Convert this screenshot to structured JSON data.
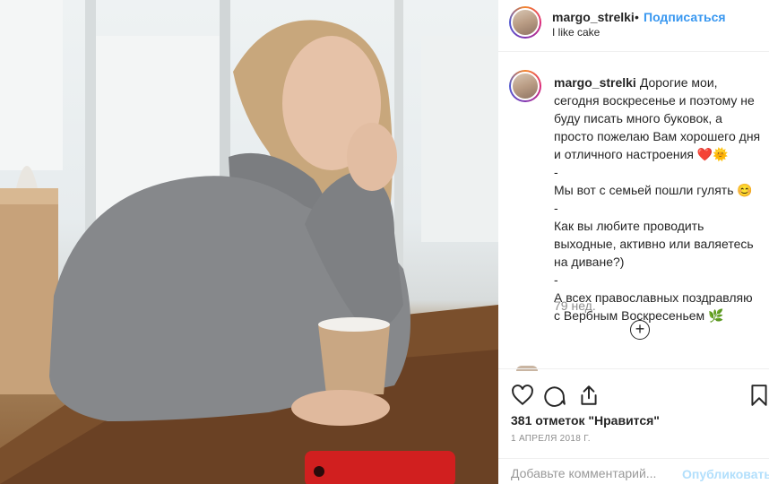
{
  "post": {
    "username": "margo_strelki",
    "dot": "•",
    "follow_label": "Подписаться",
    "location": "I like cake",
    "caption": "Дорогие мои, сегодня воскресенье и поэтому не буду писать много буковок, а просто пожелаю Вам хорошего дня и отличного настроения ❤️🌞\n-\nМы вот с семьей пошли гулять 😊\n-\nКак вы любите проводить выходные, активно или валяетесь на диване?)\n-\nА всех православных поздравляю с Вербным Воскресеньем 🌿",
    "time_ago": "79 нед.",
    "load_more_symbol": "+",
    "likes": "381 отметок \"Нравится\"",
    "date": "1 АПРЕЛЯ 2018 Г."
  },
  "comment": {
    "placeholder": "Добавьте комментарий...",
    "publish_label": "Опубликовать"
  },
  "icons": {
    "like": "heart-icon",
    "comment": "comment-icon",
    "share": "share-icon",
    "save": "bookmark-icon"
  },
  "colors": {
    "accent": "#3897f0",
    "publish_disabled": "#b2dffc",
    "muted": "#8e8e8e"
  }
}
